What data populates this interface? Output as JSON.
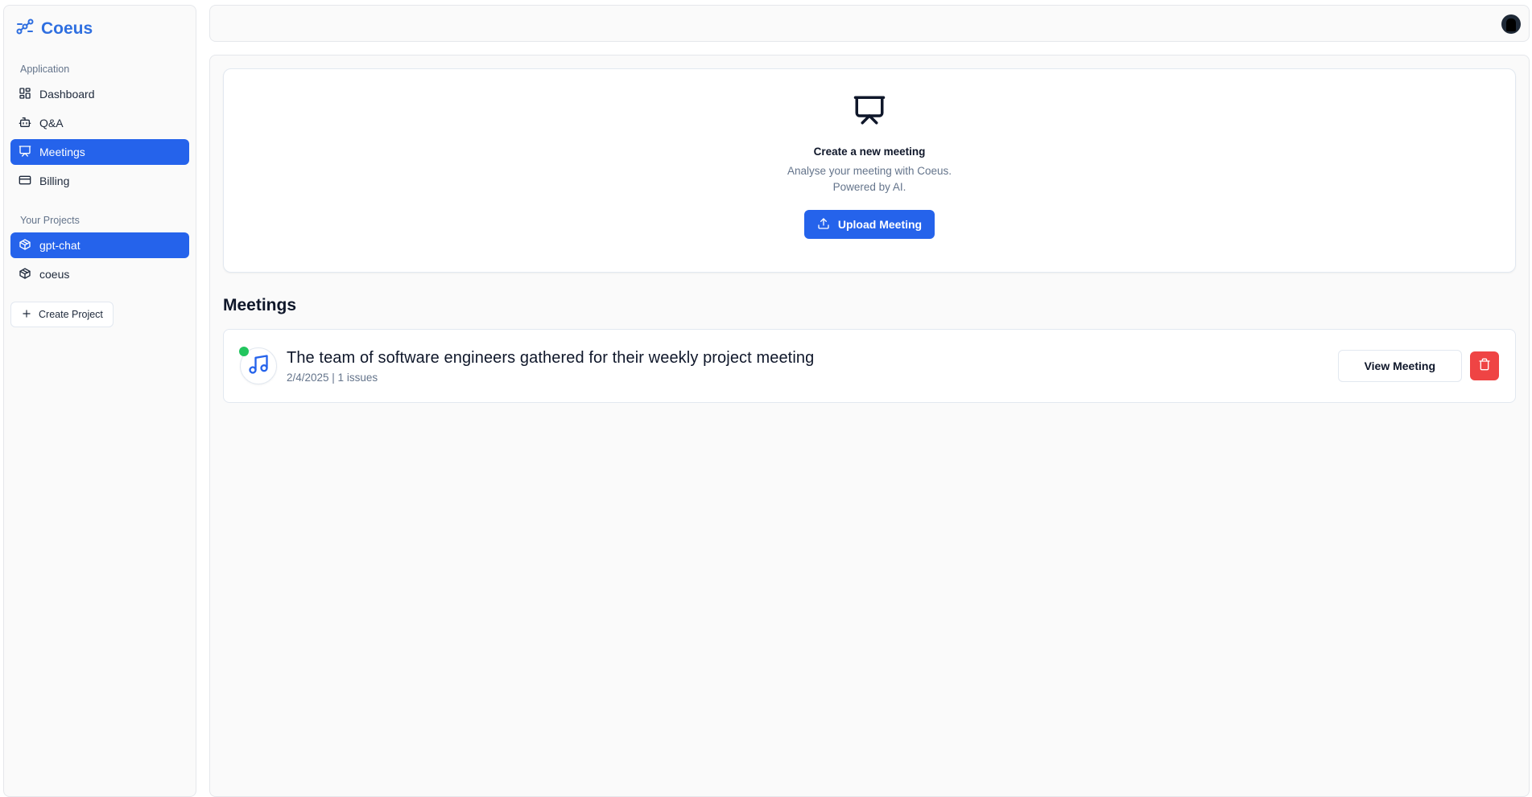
{
  "brand": {
    "name": "Coeus",
    "icon": "workflow-icon"
  },
  "sidebar": {
    "application_label": "Application",
    "items": [
      {
        "label": "Dashboard",
        "icon": "layout-dashboard-icon",
        "active": false
      },
      {
        "label": "Q&A",
        "icon": "bot-icon",
        "active": false
      },
      {
        "label": "Meetings",
        "icon": "presentation-icon",
        "active": true
      },
      {
        "label": "Billing",
        "icon": "credit-card-icon",
        "active": false
      }
    ],
    "projects_label": "Your Projects",
    "projects": [
      {
        "label": "gpt-chat",
        "icon": "package-icon",
        "active": true
      },
      {
        "label": "coeus",
        "icon": "package-icon",
        "active": false
      }
    ],
    "create_project_label": "Create Project"
  },
  "hero": {
    "title": "Create a new meeting",
    "subtitle_line1": "Analyse your meeting with Coeus.",
    "subtitle_line2": "Powered by AI.",
    "upload_label": "Upload Meeting"
  },
  "meetings": {
    "section_title": "Meetings",
    "items": [
      {
        "title": "The team of software engineers gathered for their weekly project meeting",
        "meta": "2/4/2025 | 1 issues",
        "status": "completed",
        "view_label": "View Meeting"
      }
    ]
  },
  "colors": {
    "accent": "#2563eb",
    "brand": "#2f6fe0",
    "danger": "#ef4444",
    "status_dot": "#22c55e"
  }
}
